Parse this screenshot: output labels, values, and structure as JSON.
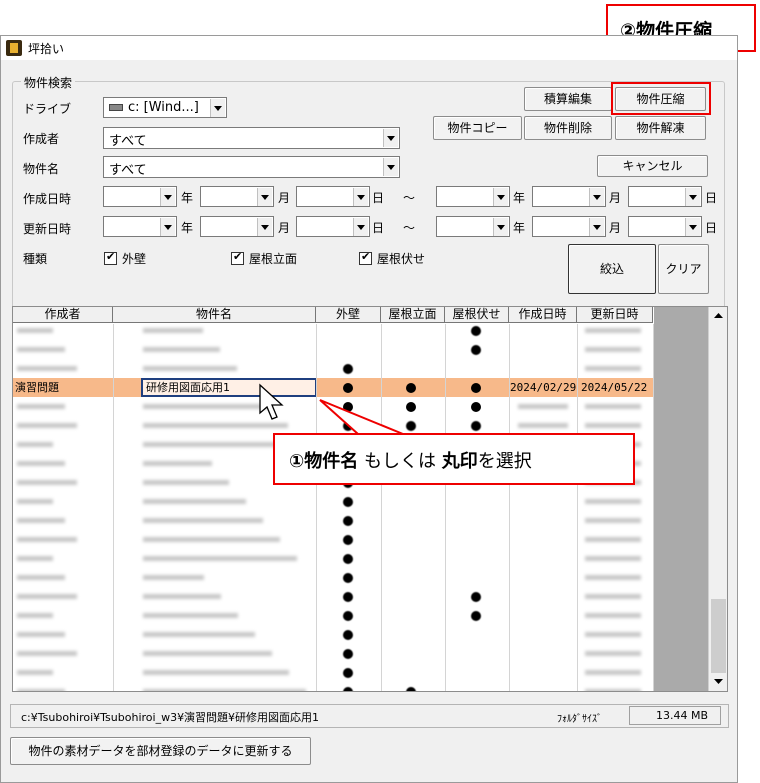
{
  "window": {
    "title": "坪拾い"
  },
  "search": {
    "group_label": "物件検索",
    "labels": {
      "drive": "ドライブ",
      "author": "作成者",
      "property_name": "物件名",
      "created": "作成日時",
      "updated": "更新日時",
      "type": "種類"
    },
    "drive_value": "c: [Wind...]",
    "author_value": "すべて",
    "property_value": "すべて",
    "date_units": {
      "year": "年",
      "month": "月",
      "day": "日",
      "range": "～"
    },
    "types": [
      {
        "label": "外壁",
        "checked": true
      },
      {
        "label": "屋根立面",
        "checked": true
      },
      {
        "label": "屋根伏せ",
        "checked": true
      }
    ]
  },
  "buttons": {
    "estimate_edit": "積算編集",
    "compress": "物件圧縮",
    "copy": "物件コピー",
    "delete": "物件削除",
    "decompress": "物件解凍",
    "cancel": "キャンセル",
    "filter": "絞込",
    "clear": "クリア",
    "update_materials": "物件の素材データを部材登録のデータに更新する"
  },
  "grid": {
    "columns": [
      "作成者",
      "物件名",
      "外壁",
      "屋根立面",
      "屋根伏せ",
      "作成日時",
      "更新日時"
    ],
    "selected_row": {
      "author": "演習問題",
      "name": "研修用図面応用1",
      "created": "2024/02/29",
      "updated": "2024/05/22"
    }
  },
  "status": {
    "path": "c:¥Tsubohiroi¥Tsubohiroi_w3¥演習問題¥研修用図面応用1",
    "folder_size_label": "ﾌｫﾙﾀﾞｻｲｽﾞ",
    "folder_size_value": "13.44 MB"
  },
  "annotations": {
    "step2": "②物件圧縮",
    "step1_prefix": "①物件名",
    "step1_mid": " もしくは ",
    "step1_bold": "丸印",
    "step1_suffix": "を選択"
  },
  "colors": {
    "accent": "#e00000",
    "selected_row": "#f7b98a",
    "selected_cell_border": "#1f3f7f"
  }
}
